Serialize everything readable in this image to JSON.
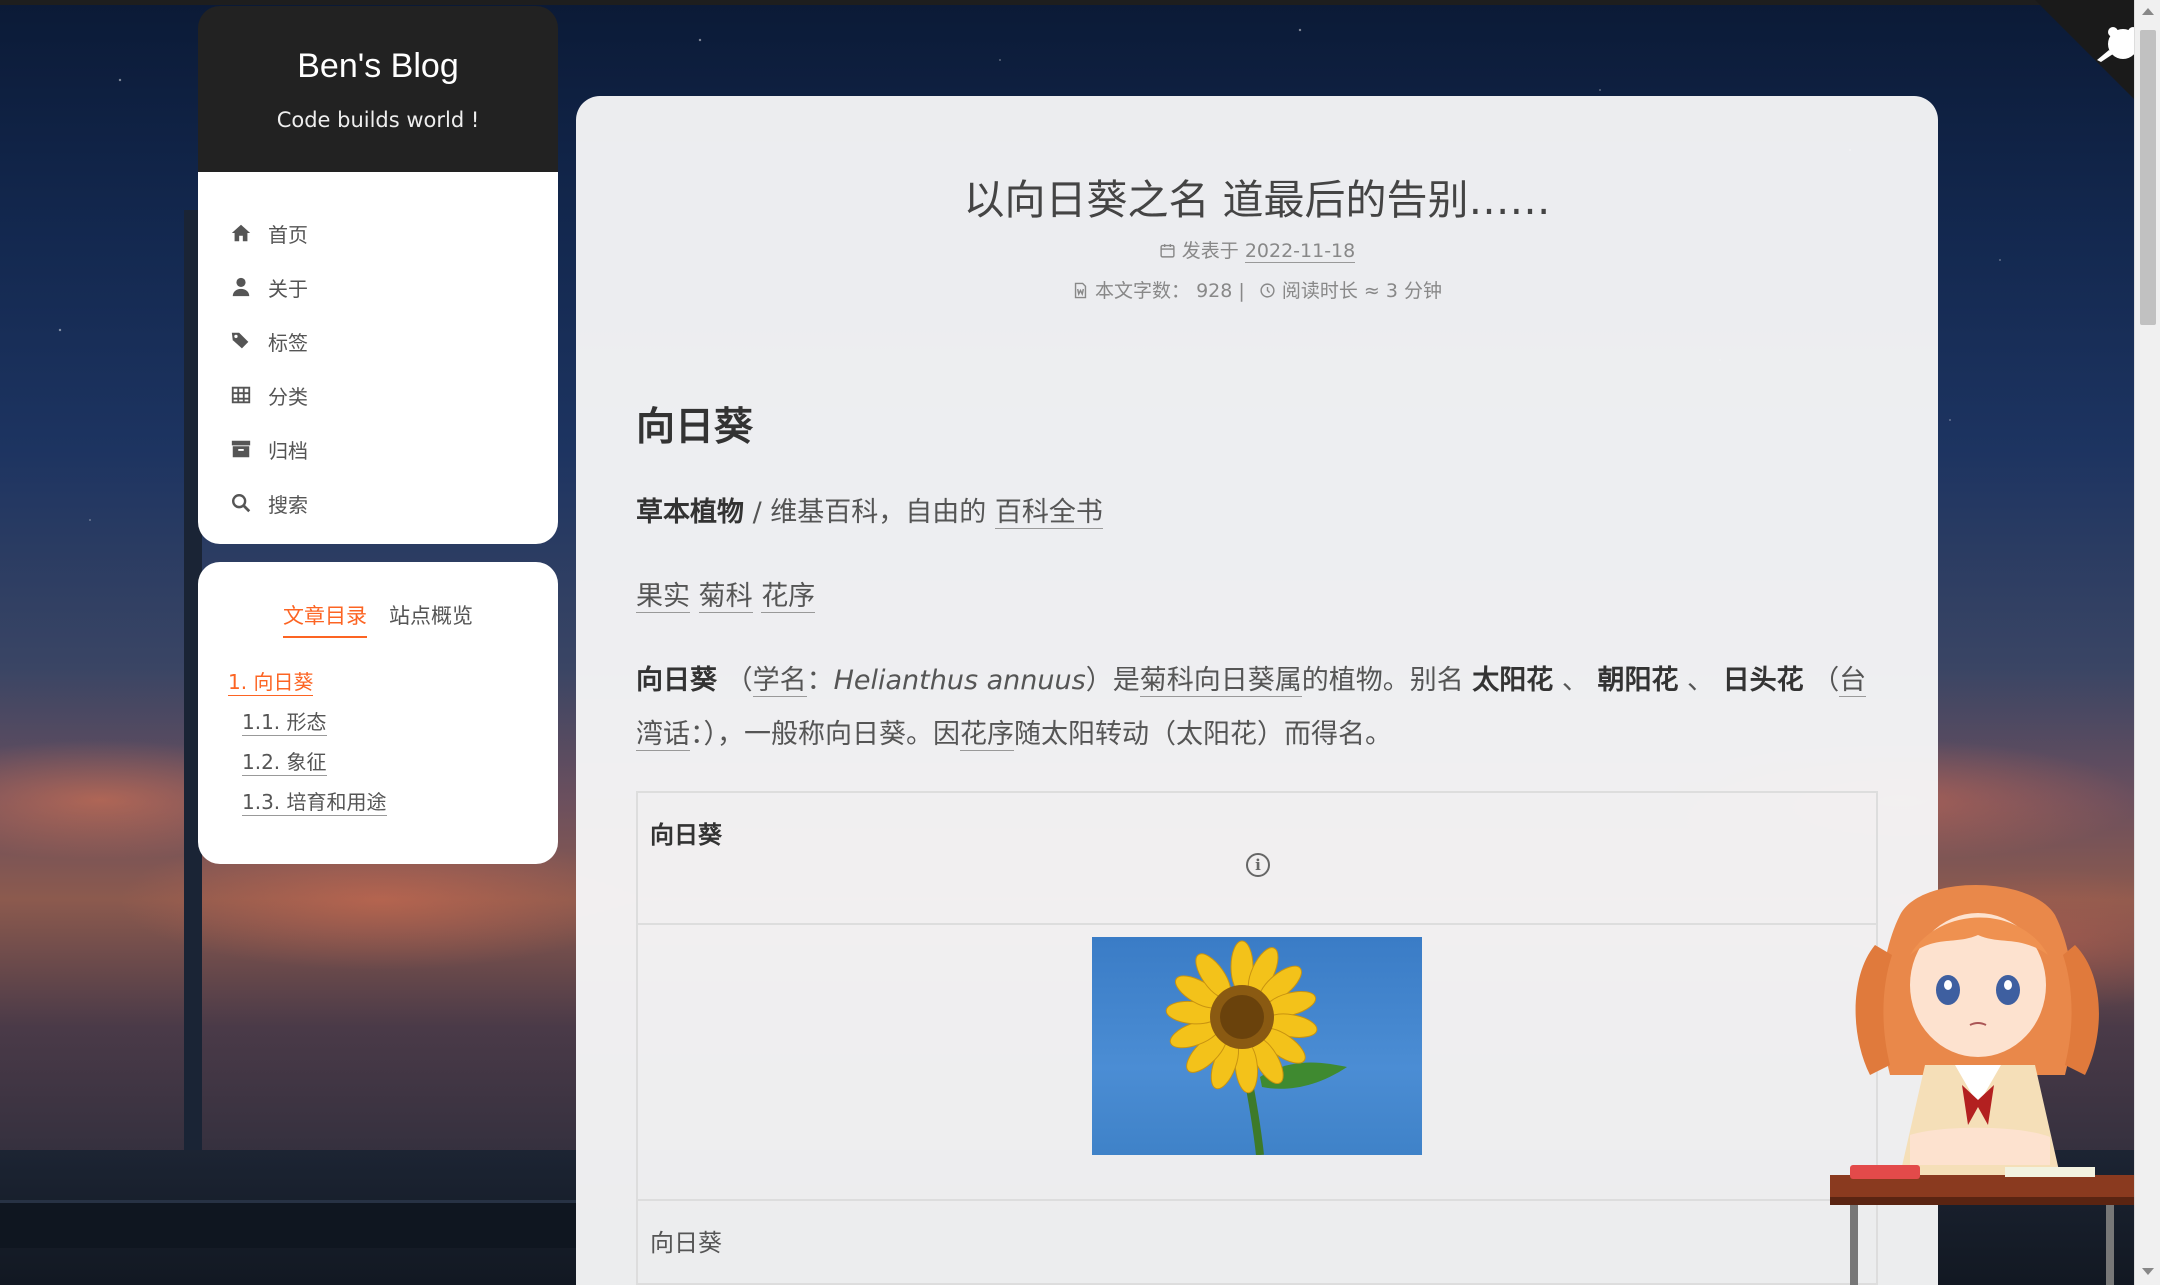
{
  "site": {
    "title": "Ben's Blog",
    "subtitle": "Code builds world !"
  },
  "menu": [
    {
      "label": "首页",
      "icon": "home-icon"
    },
    {
      "label": "关于",
      "icon": "user-icon"
    },
    {
      "label": "标签",
      "icon": "tags-icon"
    },
    {
      "label": "分类",
      "icon": "th-icon"
    },
    {
      "label": "归档",
      "icon": "archive-icon"
    },
    {
      "label": "搜索",
      "icon": "search-icon"
    }
  ],
  "toc": {
    "tabs": [
      "文章目录",
      "站点概览"
    ],
    "items": [
      {
        "label": "1. 向日葵",
        "level": 1
      },
      {
        "label": "1.1. 形态",
        "level": 2
      },
      {
        "label": "1.2. 象征",
        "level": 2
      },
      {
        "label": "1.3. 培育和用途",
        "level": 2
      }
    ]
  },
  "post": {
    "title": "以向日葵之名 道最后的告别……",
    "published_label": "发表于",
    "published_date": "2022-11-18",
    "wordcount_label": "本文字数：",
    "wordcount": "928",
    "separator": "|",
    "readtime_label": "阅读时长 ≈",
    "readtime": "3 分钟"
  },
  "content": {
    "heading": "向日葵",
    "line1_bold": "草本植物",
    "line1_rest": " / 维基百科，自由的 ",
    "line1_link": "百科全书",
    "links": [
      "果实",
      "菊科",
      "花序"
    ],
    "p_bold1": "向日葵",
    "p_t1": " （",
    "p_link1": "学名",
    "p_t2": "：",
    "p_italic": "Helianthus annuus",
    "p_t3": "）是",
    "p_link2": "菊科向日葵属",
    "p_t4": "的植物。别名 ",
    "p_bold2": "太阳花",
    "p_t5": " 、 ",
    "p_bold3": "朝阳花",
    "p_t6": " 、 ",
    "p_bold4": "日头花",
    "p_t7": " （",
    "p_link3": "台湾话",
    "p_t8": "：），一般称向日葵。因",
    "p_link4": "花序",
    "p_t9": "随太阳转动（太阳花）而得名。"
  },
  "infobox": {
    "title": "向日葵",
    "info_glyph": "i",
    "caption": "向日葵"
  },
  "colors": {
    "accent": "#fc6423",
    "brand_bg": "#222222"
  }
}
